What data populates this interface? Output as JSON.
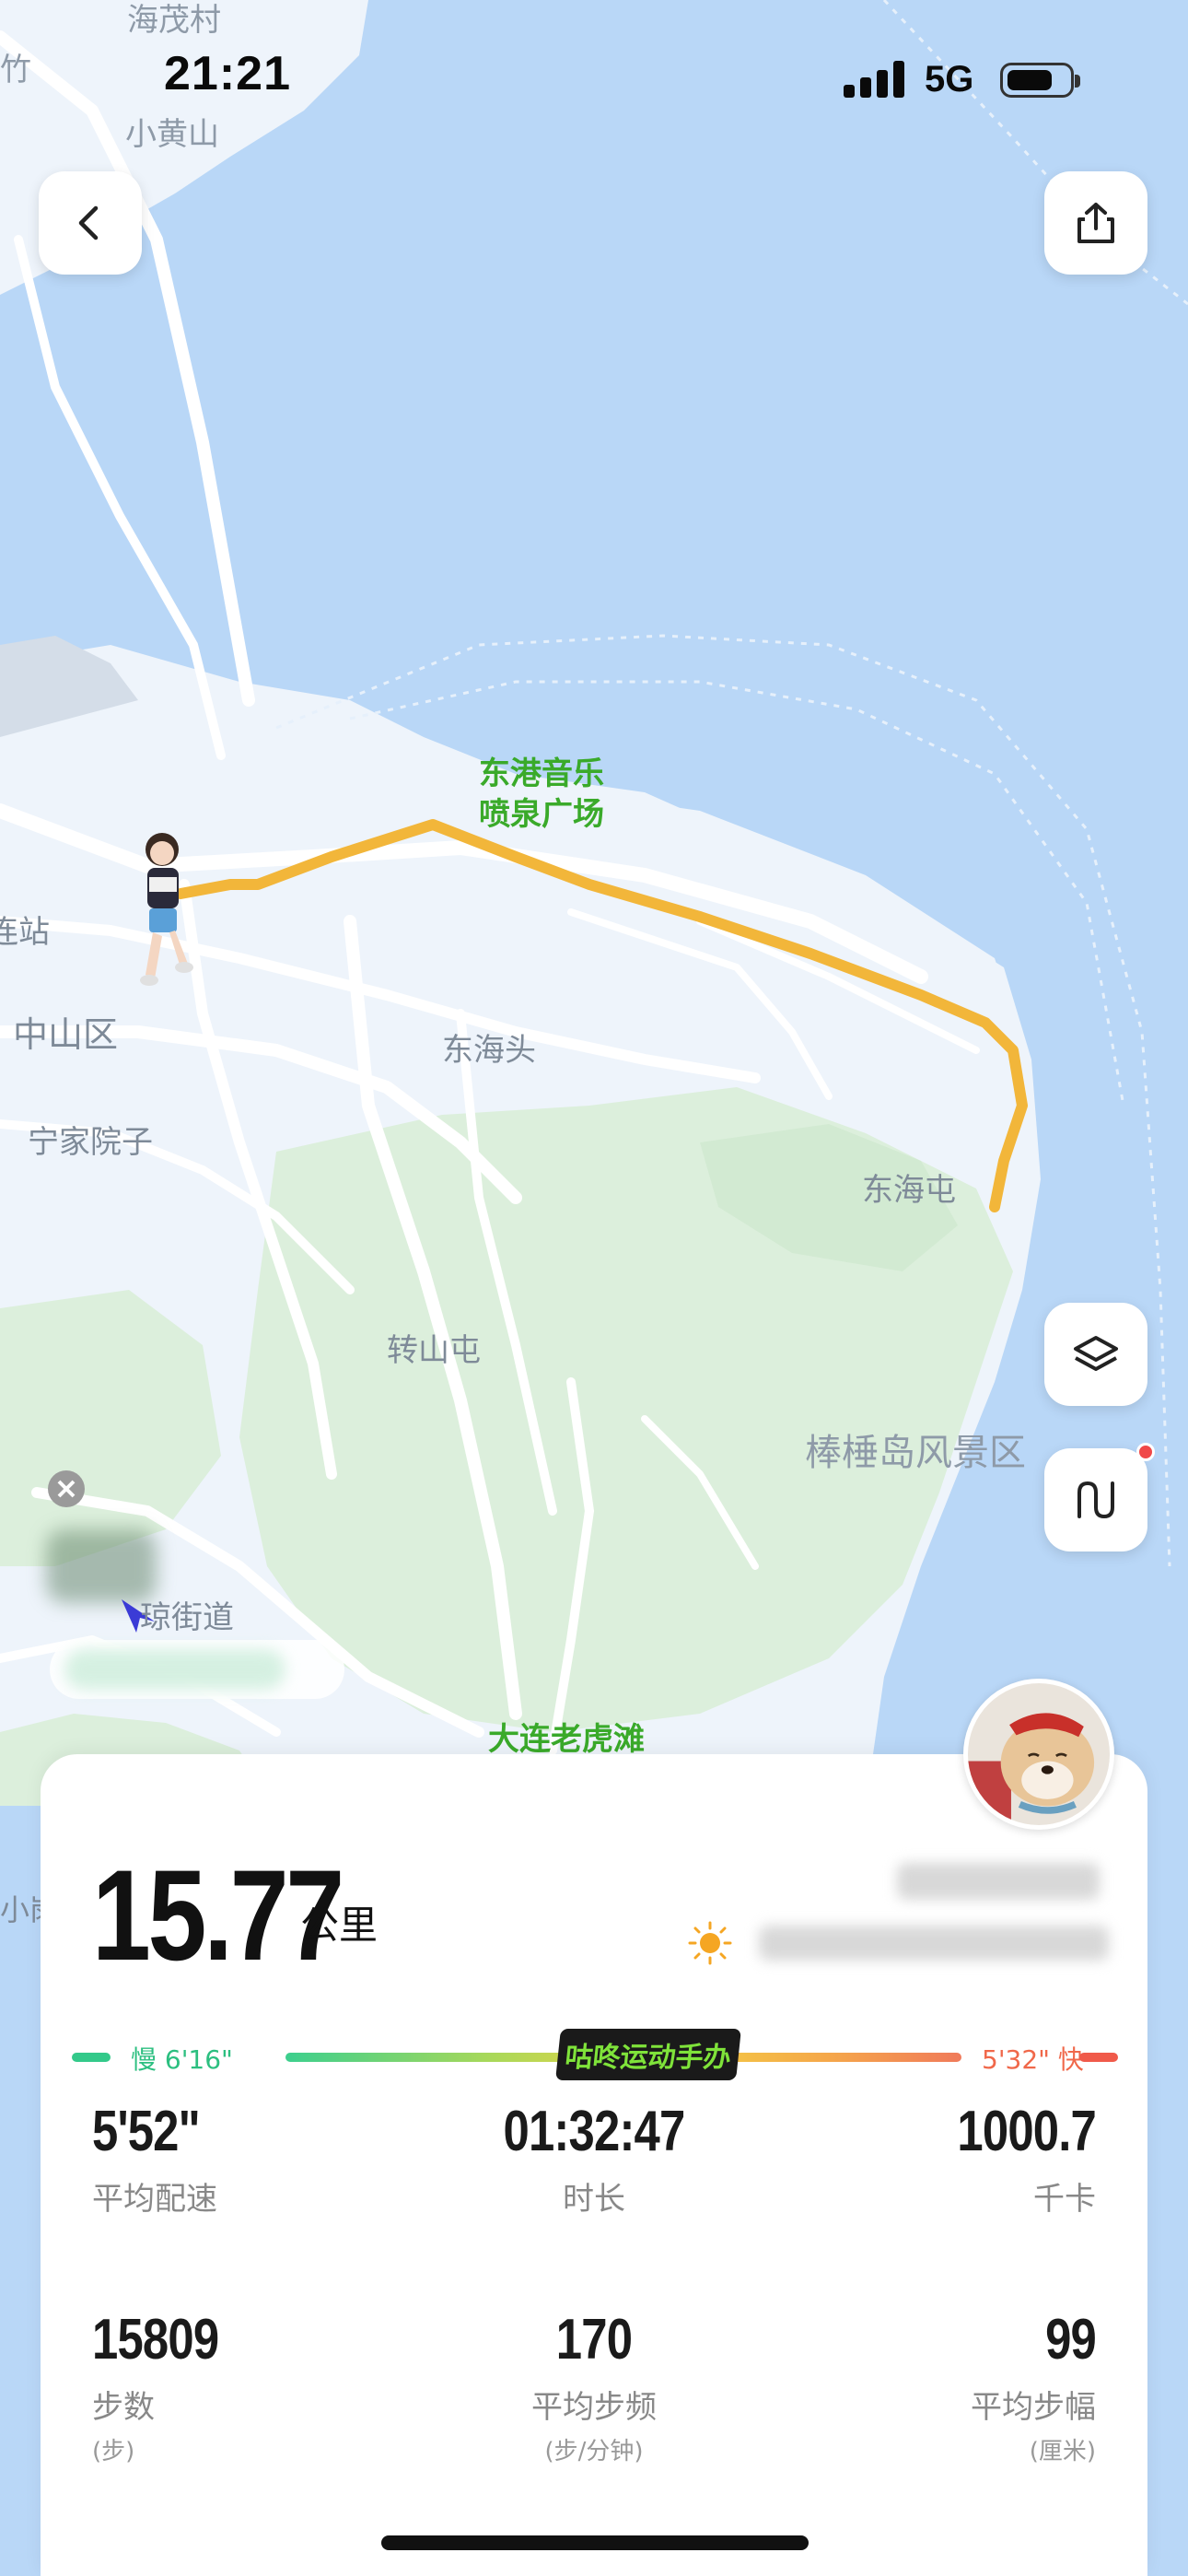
{
  "status_bar": {
    "time": "21:21",
    "network": "5G"
  },
  "map": {
    "labels": {
      "haimaocun": "海茂村",
      "zhu": "竹",
      "xiaohuangshan": "小黄山",
      "donggang_1": "东港音乐",
      "donggang_2": "喷泉广场",
      "zhan": "连站",
      "zhongshan": "中山区",
      "ningjia": "宁家院子",
      "donghaitou": "东海头",
      "donghaitun": "东海屯",
      "zhuanshantun": "转山屯",
      "bangchuidao": "棒棰岛风景区",
      "jiedao": "琼街道",
      "laohutan": "大连老虎滩",
      "xiaogang": "小岗"
    },
    "buttons": {
      "back": "back",
      "share": "share",
      "layers": "layers",
      "route": "route"
    }
  },
  "summary": {
    "distance_value": "15.77",
    "distance_unit": "公里",
    "pace_slow_label": "慢 6'16\"",
    "pace_fast_label": "5'32\" 快",
    "sticker_text": "咕咚运动手办"
  },
  "stats": [
    {
      "value": "5'52\"",
      "label": "平均配速",
      "unit": ""
    },
    {
      "value": "01:32:47",
      "label": "时长",
      "unit": ""
    },
    {
      "value": "1000.7",
      "label": "千卡",
      "unit": ""
    },
    {
      "value": "15809",
      "label": "步数",
      "unit": "(步)"
    },
    {
      "value": "170",
      "label": "平均步频",
      "unit": "(步/分钟)"
    },
    {
      "value": "99",
      "label": "平均步幅",
      "unit": "(厘米)"
    }
  ],
  "colors": {
    "route": "#f2b63a",
    "water": "#b9d7f7",
    "land": "#eef4fb",
    "park": "#dcefdc",
    "road": "#ffffff",
    "pace_slow": "#33c98a",
    "pace_fast": "#f05a4a",
    "poi_green": "#3aaa2a"
  }
}
